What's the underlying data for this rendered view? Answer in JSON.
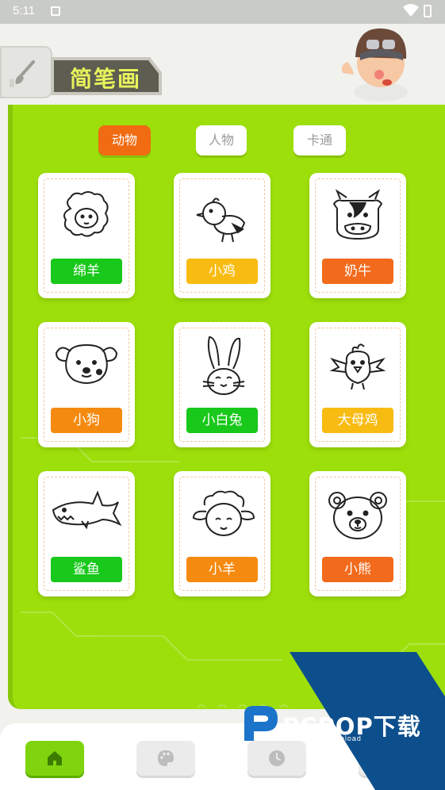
{
  "status_bar": {
    "time": "5:11"
  },
  "header": {
    "title": "简笔画"
  },
  "tabs": [
    {
      "label": "动物",
      "active": true
    },
    {
      "label": "人物",
      "active": false
    },
    {
      "label": "卡通",
      "active": false
    }
  ],
  "cards": [
    {
      "label": "绵羊",
      "icon": "sheep-drawing",
      "color": "#18c81a"
    },
    {
      "label": "小鸡",
      "icon": "chick-drawing",
      "color": "#f8bb12"
    },
    {
      "label": "奶牛",
      "icon": "cow-drawing",
      "color": "#f26a1c"
    },
    {
      "label": "小狗",
      "icon": "dog-drawing",
      "color": "#f58a10"
    },
    {
      "label": "小白兔",
      "icon": "rabbit-drawing",
      "color": "#18c81a"
    },
    {
      "label": "大母鸡",
      "icon": "hen-drawing",
      "color": "#f8bb12"
    },
    {
      "label": "鲨鱼",
      "icon": "shark-drawing",
      "color": "#18c81a"
    },
    {
      "label": "小羊",
      "icon": "lamb-drawing",
      "color": "#f58a10"
    },
    {
      "label": "小熊",
      "icon": "bear-drawing",
      "color": "#f26a1c"
    }
  ],
  "bottom_nav": [
    {
      "icon": "home-icon",
      "active": true
    },
    {
      "icon": "palette-icon",
      "active": false
    },
    {
      "icon": "clock-icon",
      "active": false
    }
  ],
  "watermark": {
    "title": "PCPOP下载",
    "subtitle": "PCPOP Download"
  },
  "colors": {
    "panel_green": "#9ddf0b",
    "tab_active": "#f06b12",
    "title_text": "#e7f35b"
  }
}
